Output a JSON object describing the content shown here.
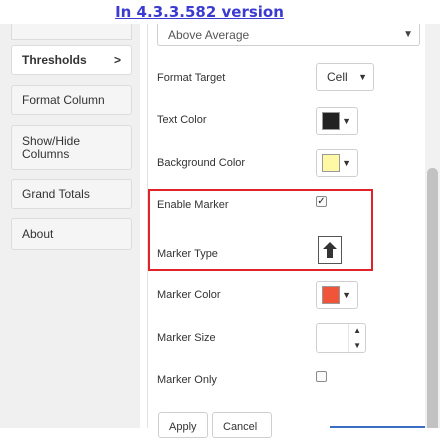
{
  "caption": "In 4.3.3.582 version",
  "sidebar": {
    "items": [
      {
        "label": "Thresholds",
        "chevron": ">",
        "active": true
      },
      {
        "label": "Format Column"
      },
      {
        "label": "Show/Hide Columns"
      },
      {
        "label": "Grand Totals"
      },
      {
        "label": "About"
      }
    ]
  },
  "form": {
    "threshold_select": {
      "value": "Above Average",
      "icon": "caret-down-icon"
    },
    "format_target": {
      "label": "Format Target",
      "value": "Cell"
    },
    "text_color": {
      "label": "Text Color",
      "color": "#222222"
    },
    "background_color": {
      "label": "Background Color",
      "color": "#fff9a6"
    },
    "enable_marker": {
      "label": "Enable Marker",
      "checked": true
    },
    "marker_type": {
      "label": "Marker Type",
      "icon": "arrow-up-icon"
    },
    "marker_color": {
      "label": "Marker Color",
      "color": "#f0553a"
    },
    "marker_size": {
      "label": "Marker Size",
      "value": ""
    },
    "marker_only": {
      "label": "Marker Only",
      "checked": false
    },
    "buttons": {
      "apply": "Apply",
      "cancel": "Cancel"
    }
  },
  "colors": {
    "highlight_border": "#e0222a",
    "caption": "#3b3bd1"
  }
}
